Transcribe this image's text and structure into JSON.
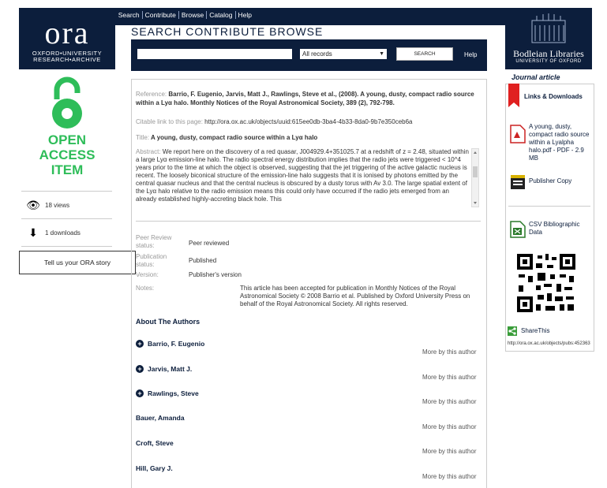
{
  "top_nav": [
    "Search",
    "Contribute",
    "Browse",
    "Catalog",
    "Help"
  ],
  "ora_logo": {
    "letters": "ora",
    "line1": "OXFORD•UNIVERSITY",
    "line2": "RESEARCH•ARCHIVE"
  },
  "open_access": {
    "line1": "OPEN",
    "line2": "ACCESS",
    "line3": "ITEM",
    "color": "#2ebd59"
  },
  "stats": {
    "views": "18 views",
    "downloads": "1 downloads"
  },
  "story_button": "Tell us your ORA story",
  "search": {
    "header": "SEARCH CONTRIBUTE BROWSE",
    "scope": "All records",
    "button": "SEARCH",
    "help": "Help"
  },
  "record": {
    "ref_label": "Reference:",
    "ref_text": "Barrio, F. Eugenio, Jarvis, Matt J., Rawlings, Steve et al., (2008). A young, dusty, compact radio source within a Lyα halo. Monthly Notices of the Royal Astronomical Society, 389 (2), 792-798.",
    "citable_label": "Citable link to this page:",
    "citable_url": "http://ora.ox.ac.uk/objects/uuid:615ee0db-3ba4-4b33-8da0-9b7e350ceb6a",
    "title_label": "Title:",
    "title_text": "A young, dusty, compact radio source within a Lyα halo",
    "abstract_label": "Abstract:",
    "abstract_text": "We report here on the discovery of a red quasar, J004929.4+351025.7 at a redshift of z = 2.48, situated within a large Lyα emission-line halo. The radio spectral energy distribution implies that the radio jets were triggered < 10^4 years prior to the time at which the object is observed, suggesting that the jet triggering of the active galactic nucleus is recent. The loosely biconical structure of the emission-line halo suggests that it is ionised by photons emitted by the central quasar nucleus and that the central nucleus is obscured by a dusty torus with Av 3.0. The large spatial extent of the Lyα halo relative to the radio emission means this could only have occurred if the radio jets emerged from an already established highly-accreting black hole. This",
    "peer_label": "Peer Review status:",
    "peer_value": "Peer reviewed",
    "pubstatus_label": "Publication status:",
    "pubstatus_value": "Published",
    "version_label": "Version:",
    "version_value": "Publisher's version",
    "notes_label": "Notes:",
    "notes_value": "This article has been accepted for publication in Monthly Notices of the Royal Astronomical Society © 2008 Barrio et al. Published by Oxford University Press on behalf of the Royal Astronomical Society. All rights reserved."
  },
  "authors_heading": "About The Authors",
  "authors": [
    "Barrio, F. Eugenio",
    "Jarvis, Matt J.",
    "Rawlings, Steve",
    "Bauer, Amanda",
    "Croft, Steve",
    "Hill, Gary J."
  ],
  "more_by_author": "More by this author",
  "bodleian": {
    "name": "Bodleian Libraries",
    "sub": "UNIVERSITY OF OXFORD"
  },
  "journal_label": "Journal article",
  "right_panel": {
    "links_heading": "Links & Downloads",
    "pdf_link": "A young, dusty, compact radio source within a Lyalpha halo.pdf - PDF - 2.9 MB",
    "publisher_copy": "Publisher Copy",
    "csv_link": "CSV Bibliographic Data",
    "share": "ShareThis",
    "url": "http://ora.ox.ac.uk/objects/pubs:452363"
  }
}
